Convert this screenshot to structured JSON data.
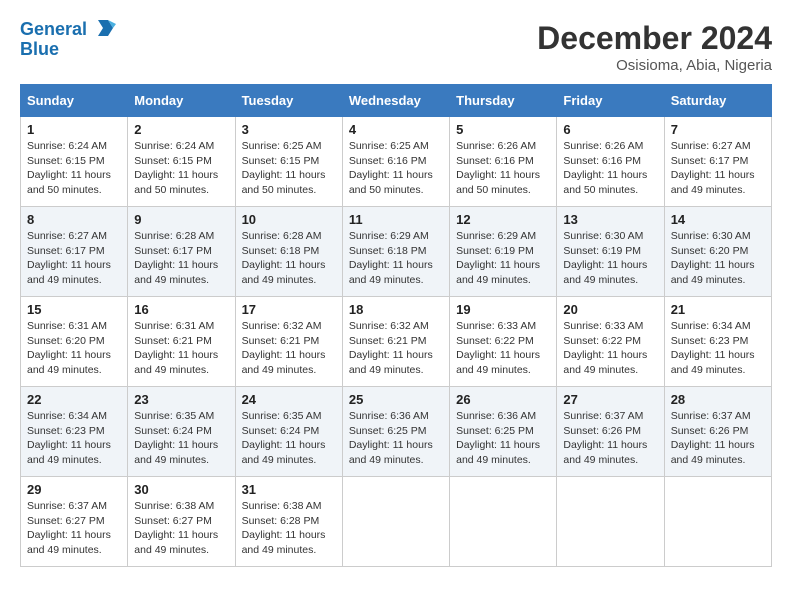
{
  "header": {
    "logo_line1": "General",
    "logo_line2": "Blue",
    "month_title": "December 2024",
    "location": "Osisioma, Abia, Nigeria"
  },
  "days_of_week": [
    "Sunday",
    "Monday",
    "Tuesday",
    "Wednesday",
    "Thursday",
    "Friday",
    "Saturday"
  ],
  "weeks": [
    [
      {
        "day": "1",
        "sunrise": "6:24 AM",
        "sunset": "6:15 PM",
        "daylight": "11 hours and 50 minutes."
      },
      {
        "day": "2",
        "sunrise": "6:24 AM",
        "sunset": "6:15 PM",
        "daylight": "11 hours and 50 minutes."
      },
      {
        "day": "3",
        "sunrise": "6:25 AM",
        "sunset": "6:15 PM",
        "daylight": "11 hours and 50 minutes."
      },
      {
        "day": "4",
        "sunrise": "6:25 AM",
        "sunset": "6:16 PM",
        "daylight": "11 hours and 50 minutes."
      },
      {
        "day": "5",
        "sunrise": "6:26 AM",
        "sunset": "6:16 PM",
        "daylight": "11 hours and 50 minutes."
      },
      {
        "day": "6",
        "sunrise": "6:26 AM",
        "sunset": "6:16 PM",
        "daylight": "11 hours and 50 minutes."
      },
      {
        "day": "7",
        "sunrise": "6:27 AM",
        "sunset": "6:17 PM",
        "daylight": "11 hours and 49 minutes."
      }
    ],
    [
      {
        "day": "8",
        "sunrise": "6:27 AM",
        "sunset": "6:17 PM",
        "daylight": "11 hours and 49 minutes."
      },
      {
        "day": "9",
        "sunrise": "6:28 AM",
        "sunset": "6:17 PM",
        "daylight": "11 hours and 49 minutes."
      },
      {
        "day": "10",
        "sunrise": "6:28 AM",
        "sunset": "6:18 PM",
        "daylight": "11 hours and 49 minutes."
      },
      {
        "day": "11",
        "sunrise": "6:29 AM",
        "sunset": "6:18 PM",
        "daylight": "11 hours and 49 minutes."
      },
      {
        "day": "12",
        "sunrise": "6:29 AM",
        "sunset": "6:19 PM",
        "daylight": "11 hours and 49 minutes."
      },
      {
        "day": "13",
        "sunrise": "6:30 AM",
        "sunset": "6:19 PM",
        "daylight": "11 hours and 49 minutes."
      },
      {
        "day": "14",
        "sunrise": "6:30 AM",
        "sunset": "6:20 PM",
        "daylight": "11 hours and 49 minutes."
      }
    ],
    [
      {
        "day": "15",
        "sunrise": "6:31 AM",
        "sunset": "6:20 PM",
        "daylight": "11 hours and 49 minutes."
      },
      {
        "day": "16",
        "sunrise": "6:31 AM",
        "sunset": "6:21 PM",
        "daylight": "11 hours and 49 minutes."
      },
      {
        "day": "17",
        "sunrise": "6:32 AM",
        "sunset": "6:21 PM",
        "daylight": "11 hours and 49 minutes."
      },
      {
        "day": "18",
        "sunrise": "6:32 AM",
        "sunset": "6:21 PM",
        "daylight": "11 hours and 49 minutes."
      },
      {
        "day": "19",
        "sunrise": "6:33 AM",
        "sunset": "6:22 PM",
        "daylight": "11 hours and 49 minutes."
      },
      {
        "day": "20",
        "sunrise": "6:33 AM",
        "sunset": "6:22 PM",
        "daylight": "11 hours and 49 minutes."
      },
      {
        "day": "21",
        "sunrise": "6:34 AM",
        "sunset": "6:23 PM",
        "daylight": "11 hours and 49 minutes."
      }
    ],
    [
      {
        "day": "22",
        "sunrise": "6:34 AM",
        "sunset": "6:23 PM",
        "daylight": "11 hours and 49 minutes."
      },
      {
        "day": "23",
        "sunrise": "6:35 AM",
        "sunset": "6:24 PM",
        "daylight": "11 hours and 49 minutes."
      },
      {
        "day": "24",
        "sunrise": "6:35 AM",
        "sunset": "6:24 PM",
        "daylight": "11 hours and 49 minutes."
      },
      {
        "day": "25",
        "sunrise": "6:36 AM",
        "sunset": "6:25 PM",
        "daylight": "11 hours and 49 minutes."
      },
      {
        "day": "26",
        "sunrise": "6:36 AM",
        "sunset": "6:25 PM",
        "daylight": "11 hours and 49 minutes."
      },
      {
        "day": "27",
        "sunrise": "6:37 AM",
        "sunset": "6:26 PM",
        "daylight": "11 hours and 49 minutes."
      },
      {
        "day": "28",
        "sunrise": "6:37 AM",
        "sunset": "6:26 PM",
        "daylight": "11 hours and 49 minutes."
      }
    ],
    [
      {
        "day": "29",
        "sunrise": "6:37 AM",
        "sunset": "6:27 PM",
        "daylight": "11 hours and 49 minutes."
      },
      {
        "day": "30",
        "sunrise": "6:38 AM",
        "sunset": "6:27 PM",
        "daylight": "11 hours and 49 minutes."
      },
      {
        "day": "31",
        "sunrise": "6:38 AM",
        "sunset": "6:28 PM",
        "daylight": "11 hours and 49 minutes."
      },
      null,
      null,
      null,
      null
    ]
  ]
}
